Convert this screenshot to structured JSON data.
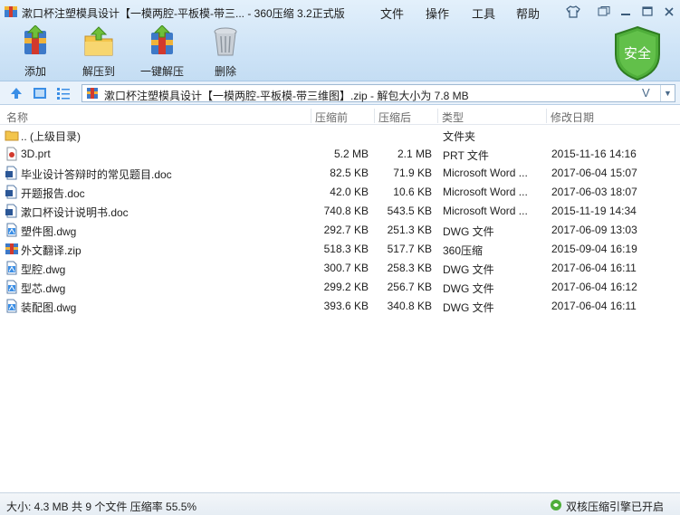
{
  "window": {
    "title": "漱口杯注塑模具设计【一模两腔-平板模-带三... - 360压缩 3.2正式版",
    "menus": [
      "文件",
      "操作",
      "工具",
      "帮助"
    ],
    "controls": [
      "shirt-icon",
      "restore-icon",
      "minimize-icon",
      "maximize-icon",
      "close-icon"
    ]
  },
  "toolbar": {
    "add_label": "添加",
    "extract_label": "解压到",
    "oneclick_label": "一键解压",
    "delete_label": "删除",
    "security_label": "安全"
  },
  "address": {
    "path": "漱口杯注塑模具设计【一模两腔-平板模-带三维图】.zip - 解包大小为 7.8 MB",
    "v_label": "V",
    "dropdown": "▼"
  },
  "columns": {
    "name": "名称",
    "before": "压缩前",
    "after": "压缩后",
    "type": "类型",
    "date": "修改日期"
  },
  "files": [
    {
      "icon": "folder-up-icon",
      "name": ".. (上级目录)",
      "before": "",
      "after": "",
      "type": "文件夹",
      "date": ""
    },
    {
      "icon": "prt-file-icon",
      "name": "3D.prt",
      "before": "5.2 MB",
      "after": "2.1 MB",
      "type": "PRT 文件",
      "date": "2015-11-16 14:16"
    },
    {
      "icon": "word-doc-icon",
      "name": "毕业设计答辩时的常见题目.doc",
      "before": "82.5 KB",
      "after": "71.9 KB",
      "type": "Microsoft Word ...",
      "date": "2017-06-04 15:07"
    },
    {
      "icon": "word-doc-icon",
      "name": "开题报告.doc",
      "before": "42.0 KB",
      "after": "10.6 KB",
      "type": "Microsoft Word ...",
      "date": "2017-06-03 18:07"
    },
    {
      "icon": "word-doc-icon",
      "name": "漱口杯设计说明书.doc",
      "before": "740.8 KB",
      "after": "543.5 KB",
      "type": "Microsoft Word ...",
      "date": "2015-11-19 14:34"
    },
    {
      "icon": "dwg-file-icon",
      "name": "塑件图.dwg",
      "before": "292.7 KB",
      "after": "251.3 KB",
      "type": "DWG 文件",
      "date": "2017-06-09 13:03"
    },
    {
      "icon": "zip-file-icon",
      "name": "外文翻译.zip",
      "before": "518.3 KB",
      "after": "517.7 KB",
      "type": "360压缩",
      "date": "2015-09-04 16:19"
    },
    {
      "icon": "dwg-file-icon",
      "name": "型腔.dwg",
      "before": "300.7 KB",
      "after": "258.3 KB",
      "type": "DWG 文件",
      "date": "2017-06-04 16:11"
    },
    {
      "icon": "dwg-file-icon",
      "name": "型芯.dwg",
      "before": "299.2 KB",
      "after": "256.7 KB",
      "type": "DWG 文件",
      "date": "2017-06-04 16:12"
    },
    {
      "icon": "dwg-file-icon",
      "name": "装配图.dwg",
      "before": "393.6 KB",
      "after": "340.8 KB",
      "type": "DWG 文件",
      "date": "2017-06-04 16:11"
    }
  ],
  "status": {
    "summary": "大小: 4.3 MB 共 9 个文件 压缩率 55.5%",
    "engine": "双核压缩引擎已开启"
  },
  "colors": {
    "accent": "#3a8ee6",
    "shield_green": "#4fae3a",
    "header_bg": "#d3e6f8"
  }
}
